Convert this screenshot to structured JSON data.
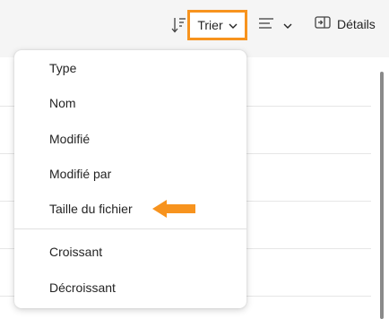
{
  "toolbar": {
    "sort_label": "Trier",
    "details_label": "Détails",
    "sort_icon": "sort-icon",
    "view_icon": "view-options-icon",
    "details_icon": "details-pane-icon",
    "highlight_color": "#f7931e"
  },
  "sort_menu": {
    "items": [
      {
        "label": "Type"
      },
      {
        "label": "Nom"
      },
      {
        "label": "Modifié"
      },
      {
        "label": "Modifié par"
      },
      {
        "label": "Taille du fichier"
      }
    ],
    "order_items": [
      {
        "label": "Croissant"
      },
      {
        "label": "Décroissant"
      }
    ]
  },
  "annotation": {
    "arrow_color": "#f7931e"
  }
}
